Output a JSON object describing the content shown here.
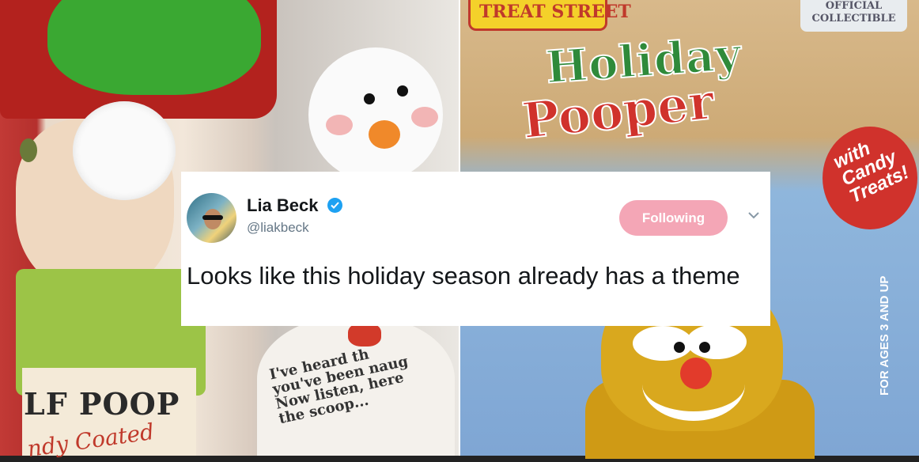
{
  "photo": {
    "left": {
      "label_title": "LF POOP",
      "label_sub": "ndy Coated",
      "snowman_text": "I've heard th\nyou've been naug\nNow listen, here\nthe scoop..."
    },
    "right": {
      "brand": "TREAT STREET",
      "collectible": "OFFICIAL\nCOLLECTIBLE",
      "title_line1": "Holiday",
      "title_line2": "Pooper",
      "candy_badge": "with\nCandy\nTreats!",
      "ages": "FOR AGES 3 AND UP"
    }
  },
  "tweet": {
    "name": "Lia Beck",
    "handle": "@liakbeck",
    "follow_label": "Following",
    "text": "Looks like this holiday season already has a theme",
    "follow_color": "#f4a6b6",
    "verified_color": "#1da1f2",
    "icons": {
      "verified": "verified-badge-icon",
      "menu": "chevron-down-icon"
    }
  }
}
